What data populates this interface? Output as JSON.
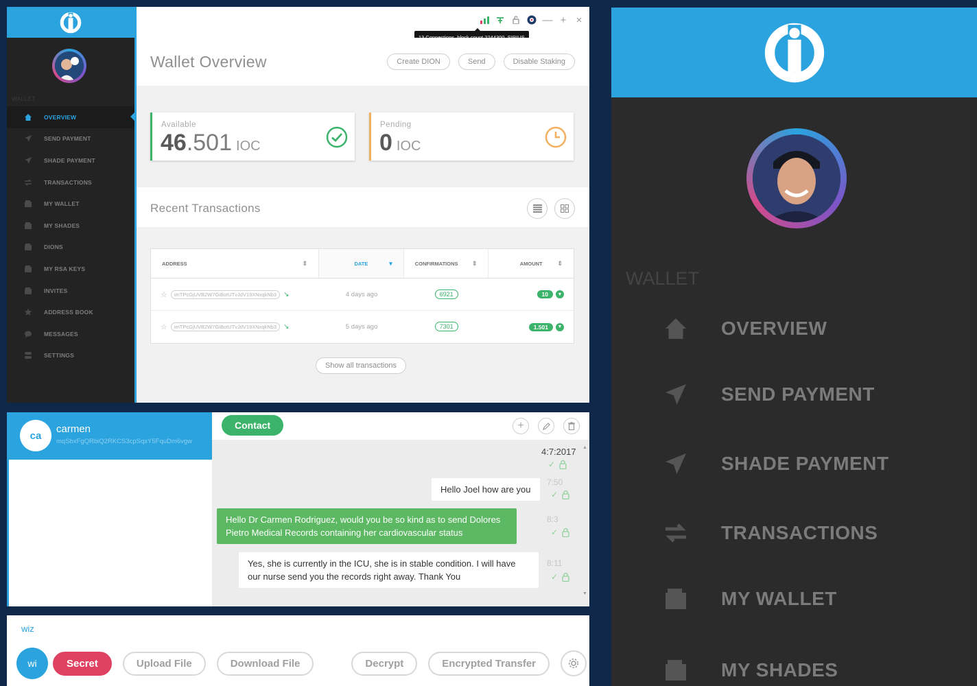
{
  "app": {
    "sidebar": {
      "section": "WALLET",
      "items": [
        {
          "label": "OVERVIEW",
          "icon": "home-icon"
        },
        {
          "label": "SEND PAYMENT",
          "icon": "paper-plane-icon"
        },
        {
          "label": "SHADE PAYMENT",
          "icon": "paper-plane-icon"
        },
        {
          "label": "TRANSACTIONS",
          "icon": "transfer-arrows-icon"
        },
        {
          "label": "MY WALLET",
          "icon": "wallet-icon"
        },
        {
          "label": "MY SHADES",
          "icon": "wallet-icon"
        },
        {
          "label": "DIONS",
          "icon": "wallet-icon"
        },
        {
          "label": "MY RSA KEYS",
          "icon": "wallet-icon"
        },
        {
          "label": "INVITES",
          "icon": "wallet-icon"
        },
        {
          "label": "ADDRESS BOOK",
          "icon": "star-icon"
        },
        {
          "label": "MESSAGES",
          "icon": "chat-bubble-icon"
        },
        {
          "label": "SETTINGS",
          "icon": "toggle-icon"
        }
      ]
    },
    "titlebar": {
      "tooltip": "13 Connections,  block count 2244300, SIRIUS",
      "icons": [
        "signal-bars-icon",
        "sync-icon",
        "lock-icon",
        "globe-icon",
        "minimize-icon",
        "maximize-icon",
        "close-icon"
      ]
    },
    "header": {
      "title": "Wallet Overview",
      "actions": [
        "Create DION",
        "Send",
        "Disable Staking"
      ]
    },
    "balances": {
      "available": {
        "label": "Available",
        "int": "46",
        "dec": ".501",
        "unit": "IOC"
      },
      "pending": {
        "label": "Pending",
        "int": "0",
        "unit": "IOC"
      }
    },
    "recent": {
      "title": "Recent Transactions",
      "columns": [
        "ADDRESS",
        "DATE",
        "CONFIRMATIONS",
        "AMOUNT"
      ],
      "rows": [
        {
          "address": "imTPcGjUVB2W7GiBotUTvJdV19XNxqkNb3",
          "date": "4 days ago",
          "confirmations": "6921",
          "amount": "10"
        },
        {
          "address": "imTPcGjUVB2W7GiBotUTvJdV19XNxqkNb3",
          "date": "5 days ago",
          "confirmations": "7301",
          "amount": "1.501"
        }
      ],
      "show_all": "Show all transactions"
    }
  },
  "chat": {
    "contact": {
      "initials": "ca",
      "name": "carmen",
      "address": "mqSbxFgQRbiQ2RKCS3cpSqxY5FquDm6vgw"
    },
    "contact_button": "Contact",
    "date": "4:7:2017",
    "messages": [
      {
        "dir": "in",
        "text": "Hello Joel how are you",
        "time": "7:50"
      },
      {
        "dir": "out",
        "text": "Hello Dr Carmen Rodriguez, would you be so kind as to send Dolores Pietro Medical Records containing her cardiovascular status",
        "time": "8:3"
      },
      {
        "dir": "in",
        "text": "Yes, she is currently in the ICU, she is in stable condition. I will have our nurse send you the records right away. Thank You",
        "time": "8:11"
      }
    ]
  },
  "compose": {
    "field": "wiz",
    "avatar": "wi",
    "buttons": [
      "Secret",
      "Upload File",
      "Download File",
      "Decrypt",
      "Encrypted Transfer"
    ]
  },
  "zoom": {
    "section": "WALLET",
    "items": [
      {
        "label": "OVERVIEW",
        "icon": "home-icon"
      },
      {
        "label": "SEND PAYMENT",
        "icon": "paper-plane-icon"
      },
      {
        "label": "SHADE PAYMENT",
        "icon": "paper-plane-icon"
      },
      {
        "label": "TRANSACTIONS",
        "icon": "transfer-arrows-icon"
      },
      {
        "label": "MY WALLET",
        "icon": "wallet-icon"
      },
      {
        "label": "MY SHADES",
        "icon": "wallet-icon"
      }
    ]
  },
  "colors": {
    "accent": "#2aa3df",
    "success": "#3bb36b",
    "danger": "#e04160",
    "sidebar": "#232323"
  }
}
